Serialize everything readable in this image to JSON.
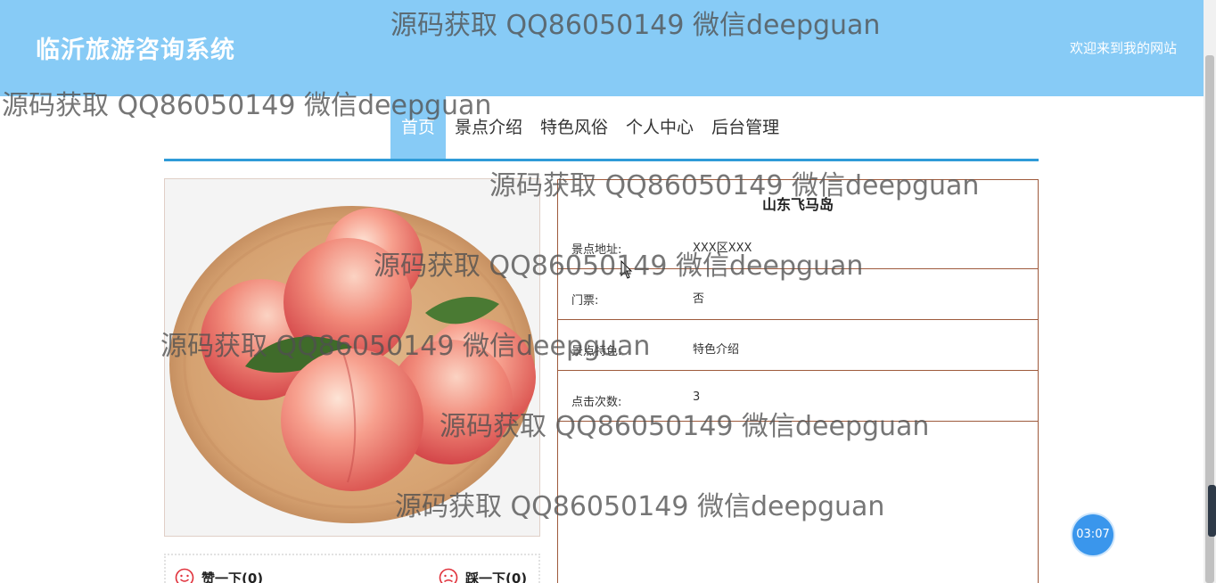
{
  "header": {
    "site_title": "临沂旅游咨询系统",
    "welcome": "欢迎来到我的网站"
  },
  "nav": {
    "items": [
      {
        "label": "首页",
        "active": true
      },
      {
        "label": "景点介绍"
      },
      {
        "label": "特色风俗"
      },
      {
        "label": "个人中心"
      },
      {
        "label": "后台管理"
      }
    ]
  },
  "detail": {
    "title": "山东飞马岛",
    "rows": [
      {
        "label": "景点地址:",
        "value": "XXX区XXX"
      },
      {
        "label": "门票:",
        "value": "否"
      },
      {
        "label": "景点特色:",
        "value": "特色介绍"
      },
      {
        "label": "点击次数:",
        "value": "3"
      }
    ]
  },
  "votes": {
    "like": "赞一下(0)",
    "dislike": "踩一下(0)"
  },
  "timer": "03:07",
  "watermark": "源码获取 QQ86050149 微信deepguan",
  "colors": {
    "header_bg": "#87cbf6",
    "nav_underline": "#2f9bd8",
    "table_border": "#9e5a3c",
    "vote_icon": "#e0313b"
  }
}
